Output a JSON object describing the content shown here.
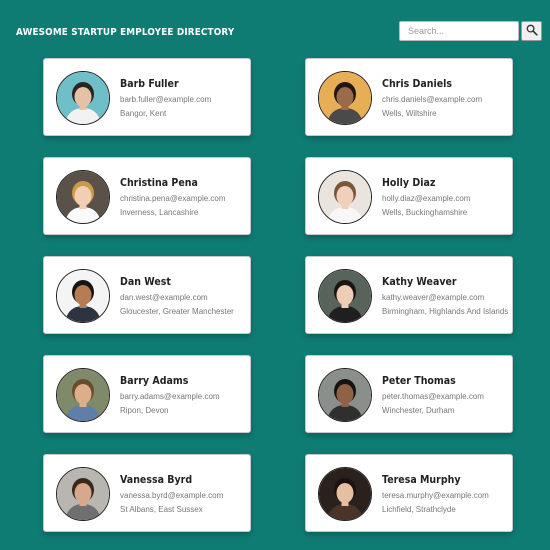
{
  "header": {
    "title": "AWESOME STARTUP EMPLOYEE DIRECTORY",
    "search_placeholder": "Search...",
    "search_icon": "magnifier-icon"
  },
  "employees": [
    {
      "name": "Barb Fuller",
      "email": "barb.fuller@example.com",
      "location": "Bangor, Kent",
      "photo_bg": "#6fbfc9",
      "skin": "#e5c2a6",
      "hair": "#2b2420",
      "shirt": "#f2f2f2"
    },
    {
      "name": "Chris Daniels",
      "email": "chris.daniels@example.com",
      "location": "Wells, Wiltshire",
      "photo_bg": "#e7ae55",
      "skin": "#9b6a48",
      "hair": "#1e1712",
      "shirt": "#4a4a4a"
    },
    {
      "name": "Christina Pena",
      "email": "christina.pena@example.com",
      "location": "Inverness, Lancashire",
      "photo_bg": "#5a5148",
      "skin": "#f2cfb3",
      "hair": "#c89a4a",
      "shirt": "#fafafa"
    },
    {
      "name": "Holly Diaz",
      "email": "holly.diaz@example.com",
      "location": "Wells, Buckinghamshire",
      "photo_bg": "#e9e4de",
      "skin": "#f0d0bb",
      "hair": "#7a5638",
      "shirt": "#f7f7f7"
    },
    {
      "name": "Dan West",
      "email": "dan.west@example.com",
      "location": "Gloucester, Greater Manchester",
      "photo_bg": "#f4f4f4",
      "skin": "#b67d55",
      "hair": "#171411",
      "shirt": "#2d3440"
    },
    {
      "name": "Kathy Weaver",
      "email": "kathy.weaver@example.com",
      "location": "Birmingham, Highlands And Islands",
      "photo_bg": "#58635c",
      "skin": "#edcdb3",
      "hair": "#1b1512",
      "shirt": "#1f1f1f"
    },
    {
      "name": "Barry Adams",
      "email": "barry.adams@example.com",
      "location": "Ripon, Devon",
      "photo_bg": "#7f8a6a",
      "skin": "#dcae89",
      "hair": "#6b4b30",
      "shirt": "#5f7ea8"
    },
    {
      "name": "Peter Thomas",
      "email": "peter.thomas@example.com",
      "location": "Winchester, Durham",
      "photo_bg": "#8b8f8c",
      "skin": "#8f6246",
      "hair": "#181310",
      "shirt": "#2f2f2f"
    },
    {
      "name": "Vanessa Byrd",
      "email": "vanessa.byrd@example.com",
      "location": "St Albans, East Sussex",
      "photo_bg": "#b9b6b2",
      "skin": "#d7a88b",
      "hair": "#3b261a",
      "shirt": "#6f6f6f"
    },
    {
      "name": "Teresa Murphy",
      "email": "teresa.murphy@example.com",
      "location": "Lichfield, Strathclyde",
      "photo_bg": "#2a211d",
      "skin": "#e6bfa2",
      "hair": "#1a1210",
      "shirt": "#4a3428"
    }
  ]
}
